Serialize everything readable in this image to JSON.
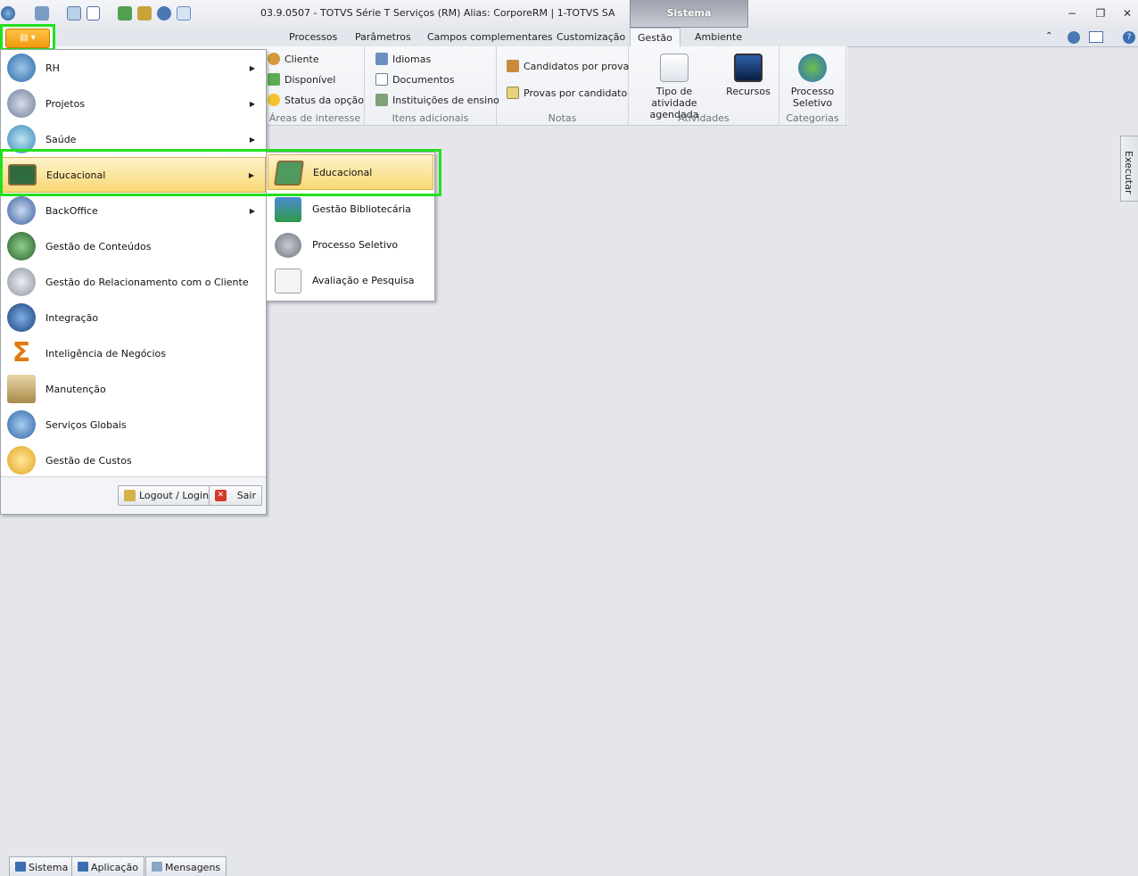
{
  "window": {
    "title": "03.9.0507 - TOTVS Série T Serviços (RM) Alias: CorporeRM | 1-TOTVS SA",
    "context_tab": "Sistema"
  },
  "ribbon_tabs": [
    "Processos",
    "Parâmetros",
    "Campos complementares",
    "Customização",
    "Gestão",
    "Ambiente"
  ],
  "ribbon": {
    "areas": {
      "label": "Áreas de interesse",
      "items": [
        "Cliente",
        "Disponível",
        "Status da opção"
      ]
    },
    "itens": {
      "label": "Itens adicionais",
      "items": [
        "Idiomas",
        "Documentos",
        "Instituições de ensino"
      ]
    },
    "notas": {
      "label": "Notas",
      "items": [
        "Candidatos por prova",
        "Provas por candidato"
      ]
    },
    "atividades": {
      "label": "Atividades",
      "tipo": "Tipo de atividade agendada",
      "recursos": "Recursos"
    },
    "categorias": {
      "label": "Categorias",
      "processo": "Processo Seletivo"
    }
  },
  "app_menu": {
    "items": [
      {
        "label": "RH",
        "arrow": "▶"
      },
      {
        "label": "Projetos",
        "arrow": "▶"
      },
      {
        "label": "Saúde",
        "arrow": "▶"
      },
      {
        "label": "Educacional",
        "arrow": "▶"
      },
      {
        "label": "BackOffice",
        "arrow": "▶"
      },
      {
        "label": "Gestão de Conteúdos"
      },
      {
        "label": "Gestão do Relacionamento com o Cliente"
      },
      {
        "label": "Integração"
      },
      {
        "label": "Inteligência de Negócios"
      },
      {
        "label": "Manutenção"
      },
      {
        "label": "Serviços Globais"
      },
      {
        "label": "Gestão de Custos"
      }
    ],
    "logout_label": "Logout / Login",
    "exit_label": "Sair"
  },
  "submenu": {
    "items": [
      "Educacional",
      "Gestão Bibliotecária",
      "Processo Seletivo",
      "Avaliação e Pesquisa"
    ]
  },
  "side_panel": {
    "label": "Executar"
  },
  "taskbar": [
    "Sistema",
    "Aplicação",
    "Mensagens"
  ],
  "colors": {
    "highlight": "#22e01e",
    "selection": "#f8d874",
    "app_button": "#f09a10"
  }
}
